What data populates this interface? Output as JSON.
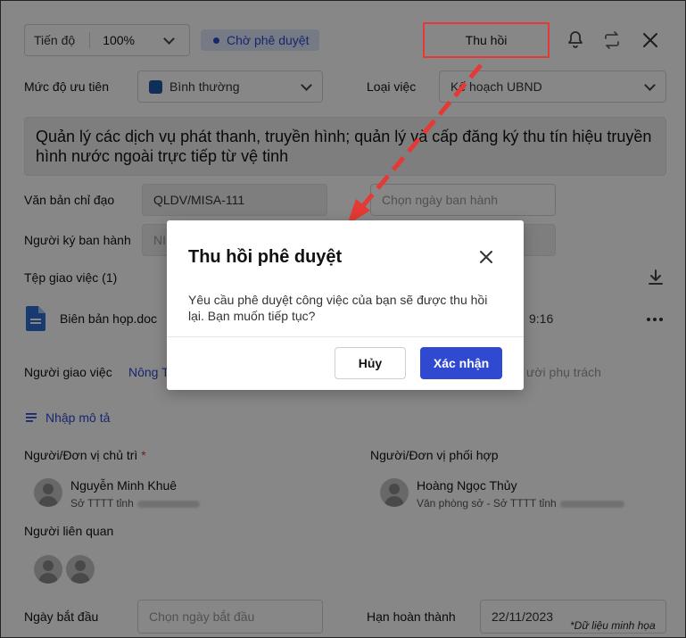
{
  "header": {
    "progress_label": "Tiến độ",
    "progress_value": "100%",
    "status": "Chờ phê duyệt",
    "recall_button": "Thu hồi"
  },
  "form": {
    "priority_label": "Mức độ ưu tiên",
    "priority_value": "Bình thường",
    "job_type_label": "Loại việc",
    "job_type_value": "Kế hoạch UBND",
    "title": "Quản lý các dịch vụ phát thanh, truyền hình; quản lý và cấp đăng ký thu tín hiệu truyền hình nước ngoài trực tiếp từ vệ tinh",
    "directive_label": "Văn bản chỉ đạo",
    "directive_value": "QLDV/MISA-111",
    "issue_date_placeholder": "Chọn ngày ban hành",
    "signer_label": "Người ký ban hành",
    "signer_value_partial": "NI",
    "files_label": "Tệp giao việc (1)",
    "file_name": "Biên bản họp.doc",
    "file_time_partial": "9:16",
    "assigner_label": "Người giao việc",
    "assigner_value_partial": "Nông T",
    "owner_placeholder_partial": "ười phụ trách",
    "add_description": "Nhập mô tả",
    "lead_label": "Người/Đơn vị chủ trì",
    "required_mark": "*",
    "lead_name": "Nguyễn Minh Khuê",
    "lead_org": "Sở TTTT tỉnh",
    "coop_label": "Người/Đơn vị phối hợp",
    "coop_name": "Hoàng Ngọc Thủy",
    "coop_org": "Văn phòng sở - Sở TTTT tỉnh",
    "related_label": "Người liên quan",
    "start_label": "Ngày bắt đầu",
    "start_placeholder": "Chọn ngày bắt đầu",
    "deadline_label": "Hạn hoàn thành",
    "deadline_value": "22/11/2023"
  },
  "dialog": {
    "title": "Thu hồi phê duyệt",
    "message": "Yêu cầu phê duyệt công việc của bạn sẽ được thu hồi lại. Bạn muốn tiếp tục?",
    "cancel": "Hủy",
    "confirm": "Xác nhận"
  },
  "footnote": "*Dữ liệu minh họa",
  "colors": {
    "accent": "#2f49d1",
    "status_bg": "#dfe6fb",
    "highlight": "#e53935",
    "priority_swatch": "#1e5aa8",
    "file_icon": "#2f6fd6"
  }
}
